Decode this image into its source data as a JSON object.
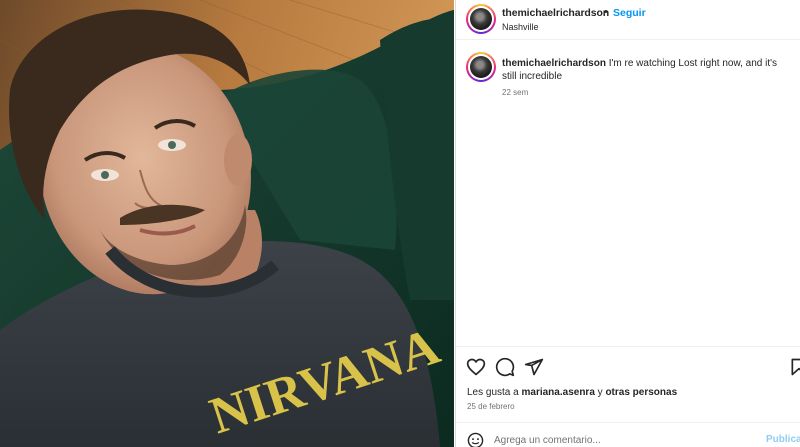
{
  "post": {
    "username": "themichaelrichardson",
    "separator": "•",
    "follow_label": "Seguir",
    "location": "Nashville"
  },
  "caption": {
    "username": "themichaelrichardson",
    "text": "I'm re watching Lost right now, and it's still incredible",
    "time_ago": "22 sem"
  },
  "actions": {
    "icons": [
      "heart-icon",
      "comment-icon",
      "share-icon",
      "bookmark-icon"
    ]
  },
  "likes": {
    "prefix": "Les gusta a",
    "user": "mariana.asenra",
    "connector": "y",
    "others": "otras personas"
  },
  "date": "25 de febrero",
  "add_comment": {
    "placeholder": "Agrega un comentario...",
    "publish_label": "Publicar"
  },
  "photo": {
    "shirt_text": "NIRVANA"
  },
  "colors": {
    "accent": "#0095f6",
    "publish_disabled": "#90cdf4",
    "text": "#262626",
    "muted": "#737373"
  }
}
